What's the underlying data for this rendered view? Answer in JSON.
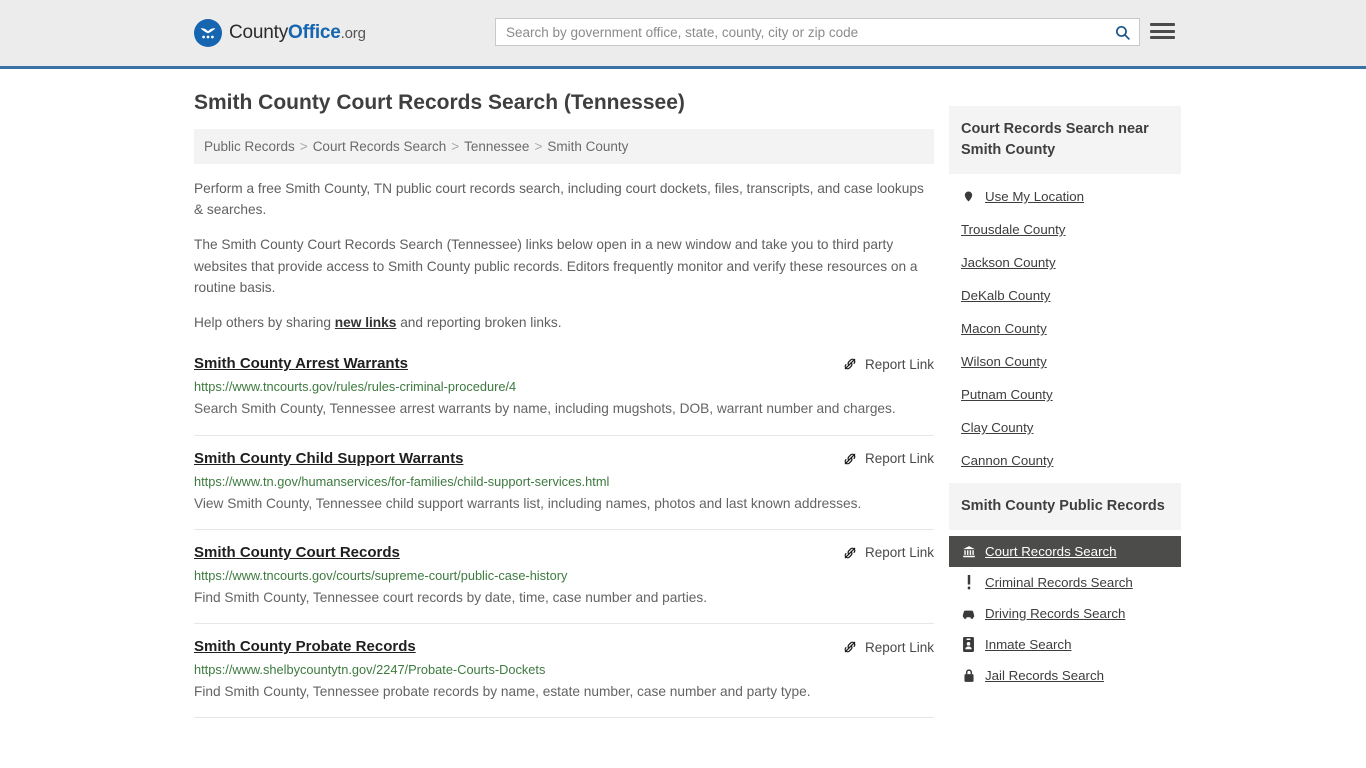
{
  "header": {
    "logo_name_1": "County",
    "logo_name_2": "Office",
    "logo_tld": ".org",
    "search_placeholder": "Search by government office, state, county, city or zip code",
    "search_value": "",
    "search_icon": "search-icon",
    "menu_icon": "hamburger-menu-icon"
  },
  "page_title": "Smith County Court Records Search (Tennessee)",
  "breadcrumb": [
    "Public Records",
    "Court Records Search",
    "Tennessee",
    "Smith County"
  ],
  "breadcrumb_separator": ">",
  "intro": {
    "p1": "Perform a free Smith County, TN public court records search, including court dockets, files, transcripts, and case lookups & searches.",
    "p2": "The Smith County Court Records Search (Tennessee) links below open in a new window and take you to third party websites that provide access to Smith County public records. Editors frequently monitor and verify these resources on a routine basis.",
    "p3_before": "Help others by sharing ",
    "p3_link": "new links",
    "p3_after": " and reporting broken links."
  },
  "report_link_label": "Report Link",
  "report_link_icon": "broken-link-icon",
  "results": [
    {
      "title": "Smith County Arrest Warrants",
      "url": "https://www.tncourts.gov/rules/rules-criminal-procedure/4",
      "description": "Search Smith County, Tennessee arrest warrants by name, including mugshots, DOB, warrant number and charges."
    },
    {
      "title": "Smith County Child Support Warrants",
      "url": "https://www.tn.gov/humanservices/for-families/child-support-services.html",
      "description": "View Smith County, Tennessee child support warrants list, including names, photos and last known addresses."
    },
    {
      "title": "Smith County Court Records",
      "url": "https://www.tncourts.gov/courts/supreme-court/public-case-history",
      "description": "Find Smith County, Tennessee court records by date, time, case number and parties."
    },
    {
      "title": "Smith County Probate Records",
      "url": "https://www.shelbycountytn.gov/2247/Probate-Courts-Dockets",
      "description": "Find Smith County, Tennessee probate records by name, estate number, case number and party type."
    }
  ],
  "sidebar": {
    "nearby": {
      "heading": "Court Records Search near Smith County",
      "items": [
        {
          "label": "Use My Location",
          "icon": "map-pin-icon"
        },
        {
          "label": "Trousdale County",
          "icon": ""
        },
        {
          "label": "Jackson County",
          "icon": ""
        },
        {
          "label": "DeKalb County",
          "icon": ""
        },
        {
          "label": "Macon County",
          "icon": ""
        },
        {
          "label": "Wilson County",
          "icon": ""
        },
        {
          "label": "Putnam County",
          "icon": ""
        },
        {
          "label": "Clay County",
          "icon": ""
        },
        {
          "label": "Cannon County",
          "icon": ""
        }
      ]
    },
    "public_records": {
      "heading": "Smith County Public Records",
      "items": [
        {
          "label": "Court Records Search",
          "icon": "courthouse-icon",
          "active": true
        },
        {
          "label": "Criminal Records Search",
          "icon": "exclamation-icon",
          "active": false
        },
        {
          "label": "Driving Records Search",
          "icon": "car-icon",
          "active": false
        },
        {
          "label": "Inmate Search",
          "icon": "id-badge-icon",
          "active": false
        },
        {
          "label": "Jail Records Search",
          "icon": "lock-icon",
          "active": false
        }
      ]
    }
  },
  "colors": {
    "header_bg": "#ececec",
    "header_border": "#3a72a8",
    "brand_blue": "#1565b0",
    "url_green": "#3d7a3f",
    "active_bg": "#4c4c4a",
    "panel_bg": "#f4f4f4"
  }
}
